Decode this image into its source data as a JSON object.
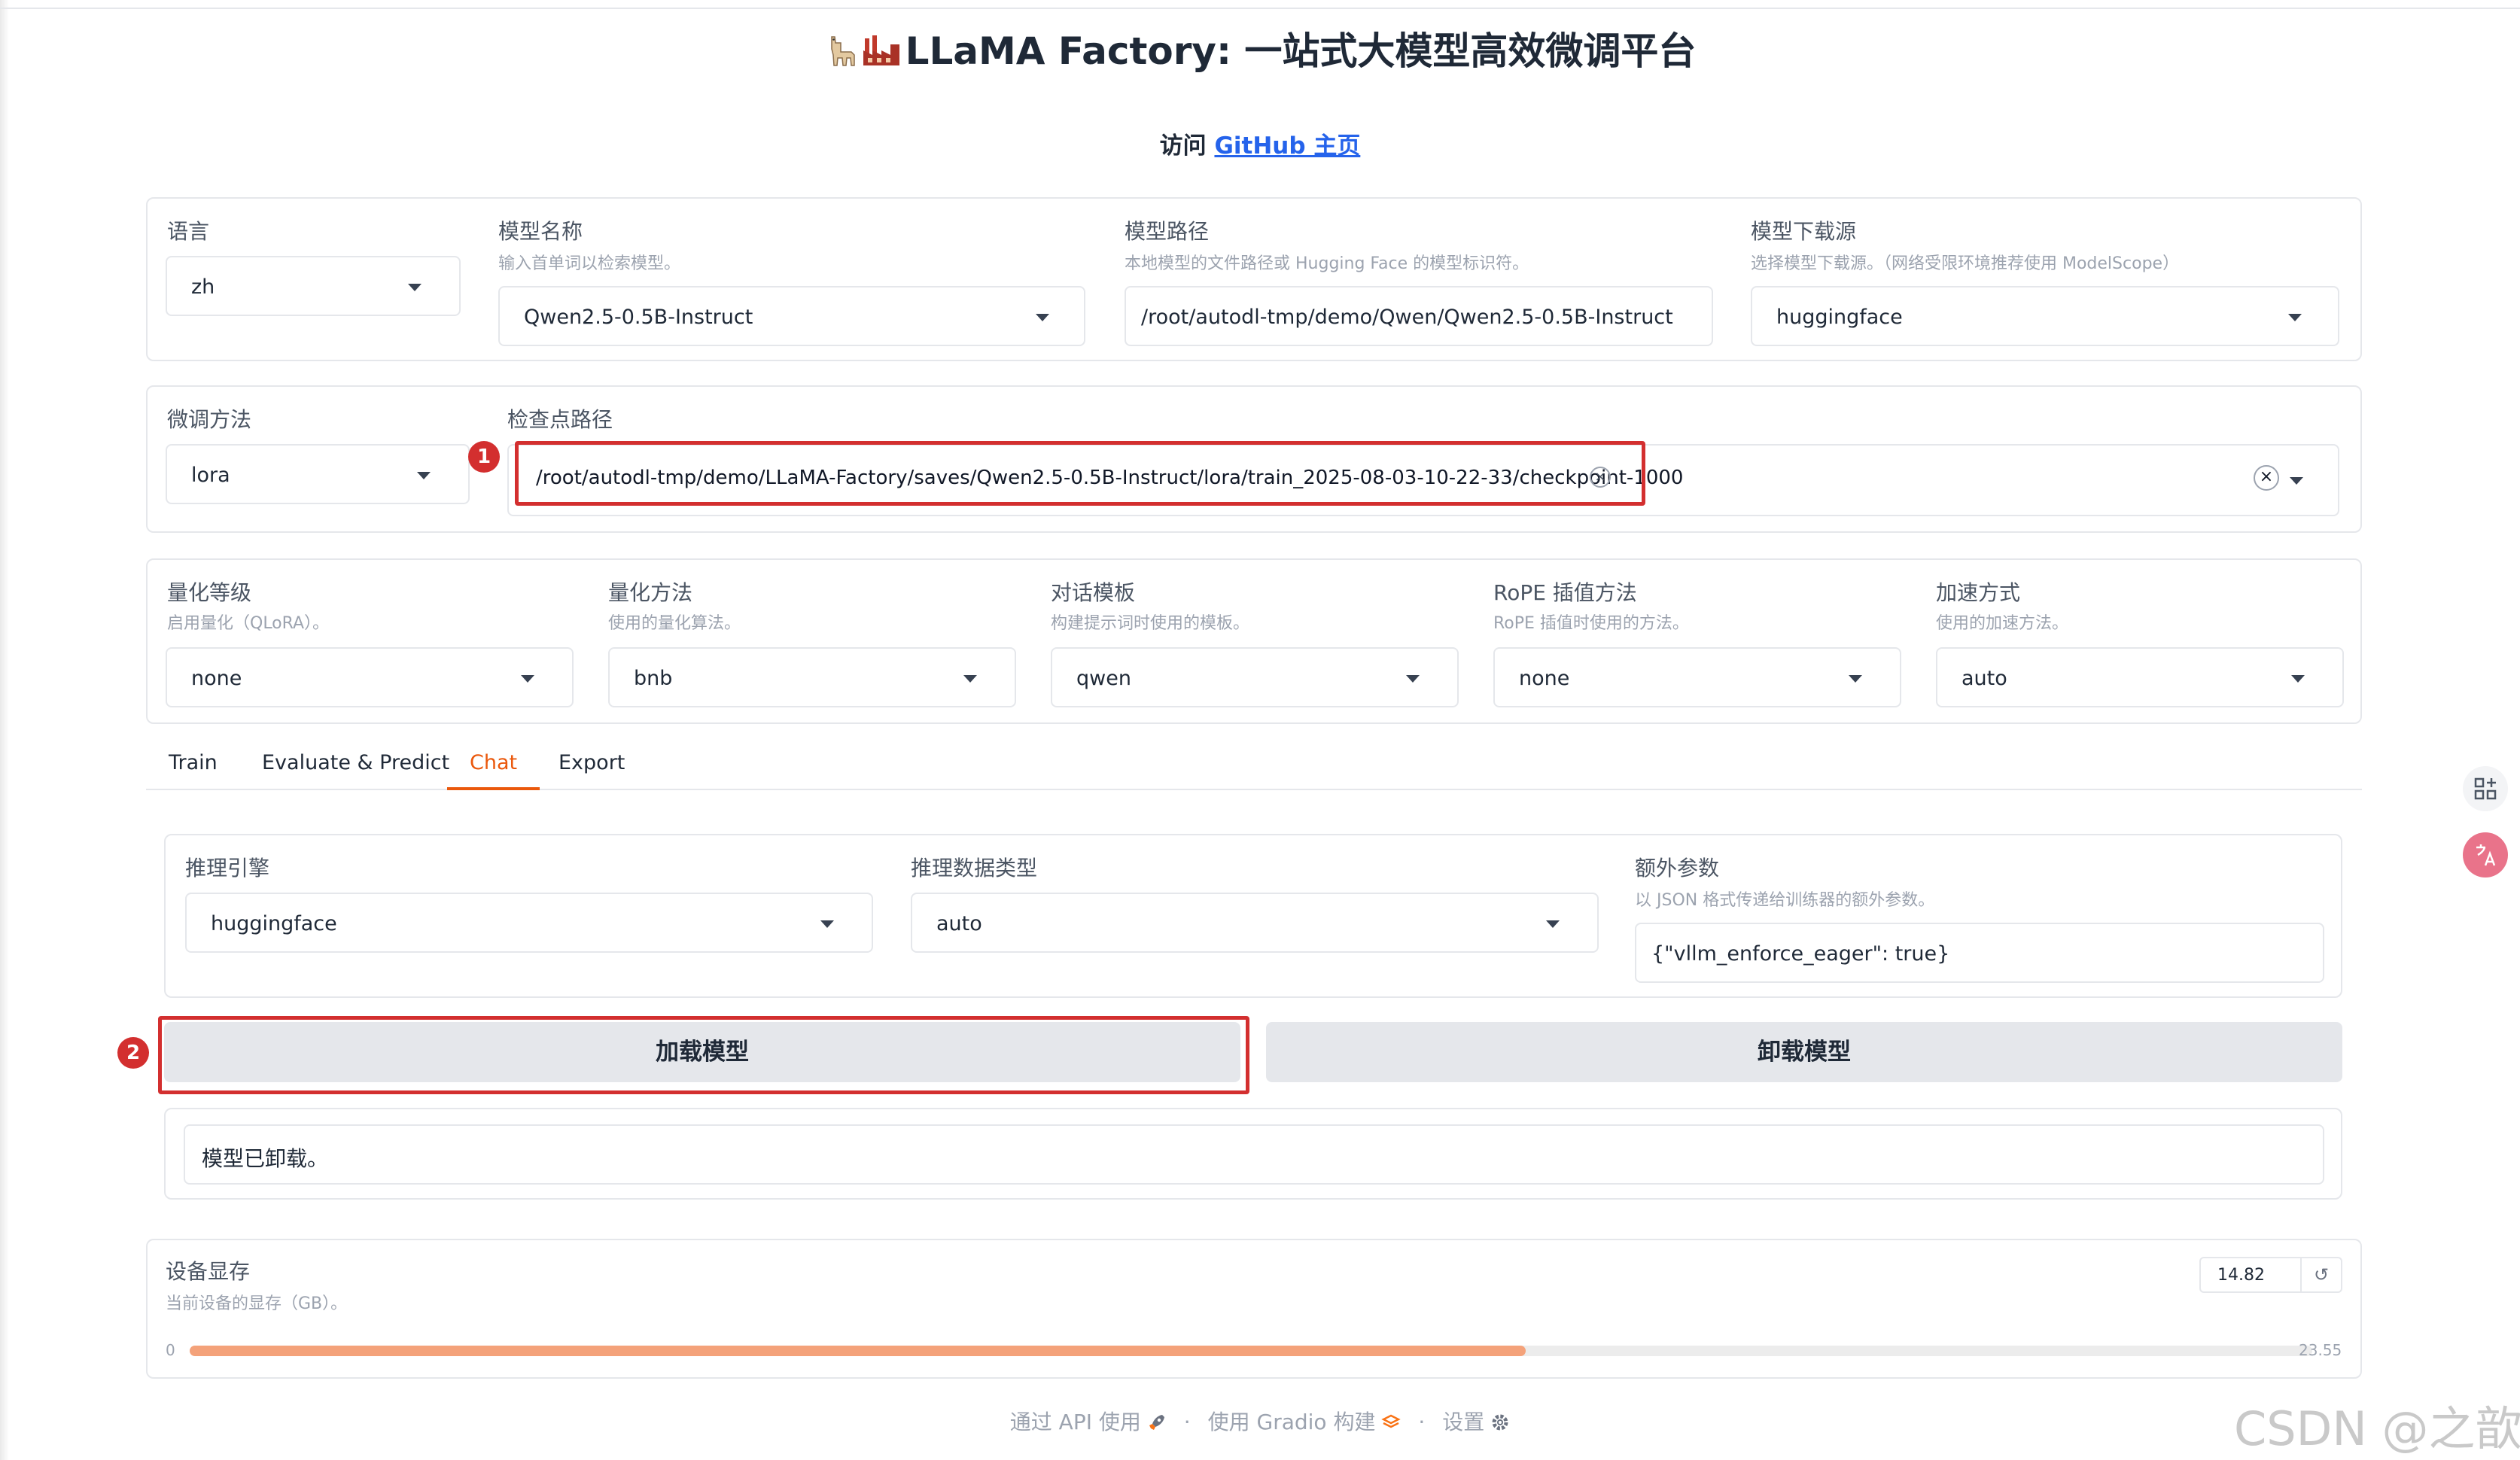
{
  "page": {
    "title": "LLaMA Factory: 一站式大模型高效微调平台",
    "visit_prefix": "访问",
    "github_link": "GitHub 主页"
  },
  "top_row": {
    "lang": {
      "label": "语言",
      "value": "zh"
    },
    "model_name": {
      "label": "模型名称",
      "info": "输入首单词以检索模型。",
      "value": "Qwen2.5-0.5B-Instruct"
    },
    "model_path": {
      "label": "模型路径",
      "info": "本地模型的文件路径或 Hugging Face 的模型标识符。",
      "value": "/root/autodl-tmp/demo/Qwen/Qwen2.5-0.5B-Instruct"
    },
    "hub": {
      "label": "模型下载源",
      "info": "选择模型下载源。（网络受限环境推荐使用 ModelScope）",
      "value": "huggingface"
    }
  },
  "finetune_row": {
    "method": {
      "label": "微调方法",
      "value": "lora"
    },
    "checkpoint": {
      "label": "检查点路径",
      "value": "/root/autodl-tmp/demo/LLaMA-Factory/saves/Qwen2.5-0.5B-Instruct/lora/train_2025-08-03-10-22-33/checkpoint-1000"
    }
  },
  "quant_row": {
    "quant_bit": {
      "label": "量化等级",
      "info": "启用量化（QLoRA）。",
      "value": "none"
    },
    "quant_method": {
      "label": "量化方法",
      "info": "使用的量化算法。",
      "value": "bnb"
    },
    "template": {
      "label": "对话模板",
      "info": "构建提示词时使用的模板。",
      "value": "qwen"
    },
    "rope": {
      "label": "RoPE 插值方法",
      "info": "RoPE 插值时使用的方法。",
      "value": "none"
    },
    "booster": {
      "label": "加速方式",
      "info": "使用的加速方法。",
      "value": "auto"
    }
  },
  "tabs": [
    {
      "label": "Train"
    },
    {
      "label": "Evaluate & Predict"
    },
    {
      "label": "Chat",
      "active": true
    },
    {
      "label": "Export"
    }
  ],
  "chat": {
    "infer_backend": {
      "label": "推理引擎",
      "value": "huggingface"
    },
    "infer_dtype": {
      "label": "推理数据类型",
      "value": "auto"
    },
    "extra_args": {
      "label": "额外参数",
      "info": "以 JSON 格式传递给训练器的额外参数。",
      "value": "{\"vllm_enforce_eager\": true}"
    },
    "load_button": "加载模型",
    "unload_button": "卸载模型",
    "status": "模型已卸载。"
  },
  "device_memory": {
    "label": "设备显存",
    "info": "当前设备的显存（GB）。",
    "value": "14.82",
    "min": "0",
    "max": "23.55",
    "fraction": 0.6293
  },
  "annotations": {
    "badge1": "1",
    "badge2": "2"
  },
  "footer": {
    "api": "通过 API 使用",
    "gradio": "使用 Gradio 构建",
    "settings": "设置"
  },
  "watermark": "CSDN @之歆",
  "colors": {
    "accent": "#ea580c",
    "annotation": "#d32f2f",
    "link": "#2563eb",
    "slider": "#f4a27a"
  }
}
